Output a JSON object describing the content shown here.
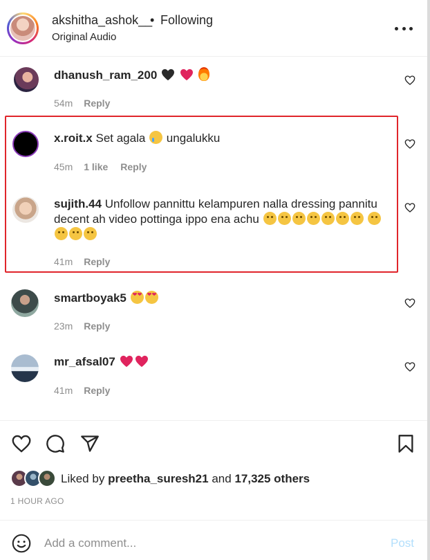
{
  "header": {
    "username": "akshitha_ashok__",
    "separator": "•",
    "follow_status": "Following",
    "audio": "Original Audio",
    "more_icon": "more-horizontal-icon"
  },
  "comments": [
    {
      "username": "dhanush_ram_200",
      "text": "",
      "emojis": [
        "black-heart",
        "red-heart",
        "fire"
      ],
      "time": "54m",
      "likes": "",
      "reply": "Reply"
    },
    {
      "username": "x.roit.x",
      "text": "Set agala",
      "text_after": "ungalukku",
      "emojis": [
        "crying-face"
      ],
      "time": "45m",
      "likes": "1 like",
      "reply": "Reply"
    },
    {
      "username": "sujith.44",
      "text": "Unfollow pannittu kelampuren nalla dressing pannitu decent ah video pottinga ippo ena achu",
      "emojis": [
        "pensive-face",
        "pensive-face",
        "pensive-face",
        "pensive-face",
        "pensive-face",
        "pensive-face",
        "pensive-face",
        "pensive-face",
        "pensive-face",
        "pensive-face",
        "pensive-face"
      ],
      "time": "41m",
      "likes": "",
      "reply": "Reply"
    },
    {
      "username": "smartboyak5",
      "text": "",
      "emojis": [
        "heart-eyes-face",
        "heart-eyes-face"
      ],
      "time": "23m",
      "likes": "",
      "reply": "Reply"
    },
    {
      "username": "mr_afsal07",
      "text": "",
      "emojis": [
        "red-heart",
        "red-heart"
      ],
      "time": "41m",
      "likes": "",
      "reply": "Reply"
    }
  ],
  "highlight_color": "#e0242a",
  "footer": {
    "liked_by_prefix": "Liked by",
    "liked_by_user": "preetha_suresh21",
    "liked_by_and": "and",
    "liked_by_others": "17,325 others",
    "time_ago": "1 HOUR AGO",
    "comment_placeholder": "Add a comment...",
    "post_label": "Post"
  },
  "colors": {
    "text": "#262626",
    "muted": "#8e8e8e",
    "post_disabled": "#b2dffc",
    "heart_red": "#e0245e"
  }
}
